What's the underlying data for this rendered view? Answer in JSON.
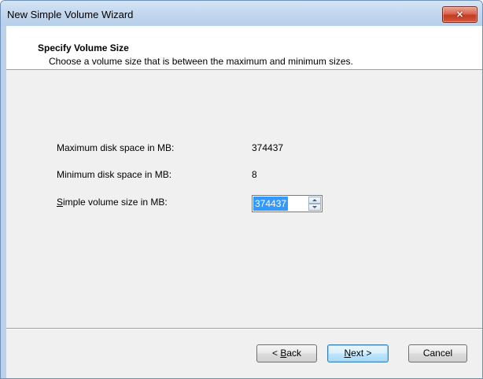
{
  "window": {
    "title": "New Simple Volume Wizard",
    "close_label": "×"
  },
  "header": {
    "title": "Specify Volume Size",
    "subtitle": "Choose a volume size that is between the maximum and minimum sizes."
  },
  "fields": {
    "max_label": "Maximum disk space in MB:",
    "max_value": "374437",
    "min_label": "Minimum disk space in MB:",
    "min_value": "8",
    "size_label_accel": "S",
    "size_label_rest": "imple volume size in MB:",
    "size_value": "374437"
  },
  "buttons": {
    "back_prefix": "< ",
    "back_accel": "B",
    "back_rest": "ack",
    "next_accel": "N",
    "next_rest": "ext >",
    "cancel": "Cancel"
  },
  "colors": {
    "selection": "#3399ff",
    "title_bar": "#c4d8ef",
    "close_button": "#c23b21",
    "client_background": "#f0f0f0"
  }
}
